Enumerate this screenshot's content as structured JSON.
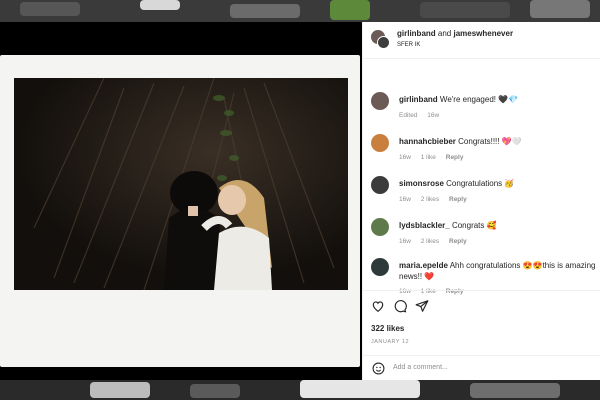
{
  "post": {
    "header": {
      "username": "girlinband",
      "joiner": " and ",
      "collaborator": "jameswhenever",
      "location": "SFER IK"
    },
    "caption": {
      "username": "girlinband",
      "text": "We're engaged! 🖤💎",
      "edited": "Edited",
      "age": "16w"
    },
    "comments": [
      {
        "username": "hannahcbieber",
        "text": "Congrats!!!! 💖🤍",
        "age": "16w",
        "likes": "1 like",
        "reply": "Reply",
        "avatar_color": "#c9803e"
      },
      {
        "username": "simonsrose",
        "text": "Congratulations 🥳",
        "age": "16w",
        "likes": "2 likes",
        "reply": "Reply",
        "avatar_color": "#3b3b3b"
      },
      {
        "username": "lydsblackler_",
        "text": "Congrats 🥰",
        "age": "16w",
        "likes": "2 likes",
        "reply": "Reply",
        "avatar_color": "#5f7a4a"
      },
      {
        "username": "maria.epelde",
        "text": "Ahh congratulations 😍😍this is amazing news!! ❤️",
        "age": "16w",
        "likes": "1 like",
        "reply": "Reply",
        "avatar_color": "#2e3a3a"
      }
    ],
    "likes": "322 likes",
    "date": "JANUARY 12",
    "add_comment_placeholder": "Add a comment...",
    "icons": {
      "like": "heart-icon",
      "comment": "comment-icon",
      "share": "share-icon",
      "emoji": "smiley-icon"
    }
  }
}
